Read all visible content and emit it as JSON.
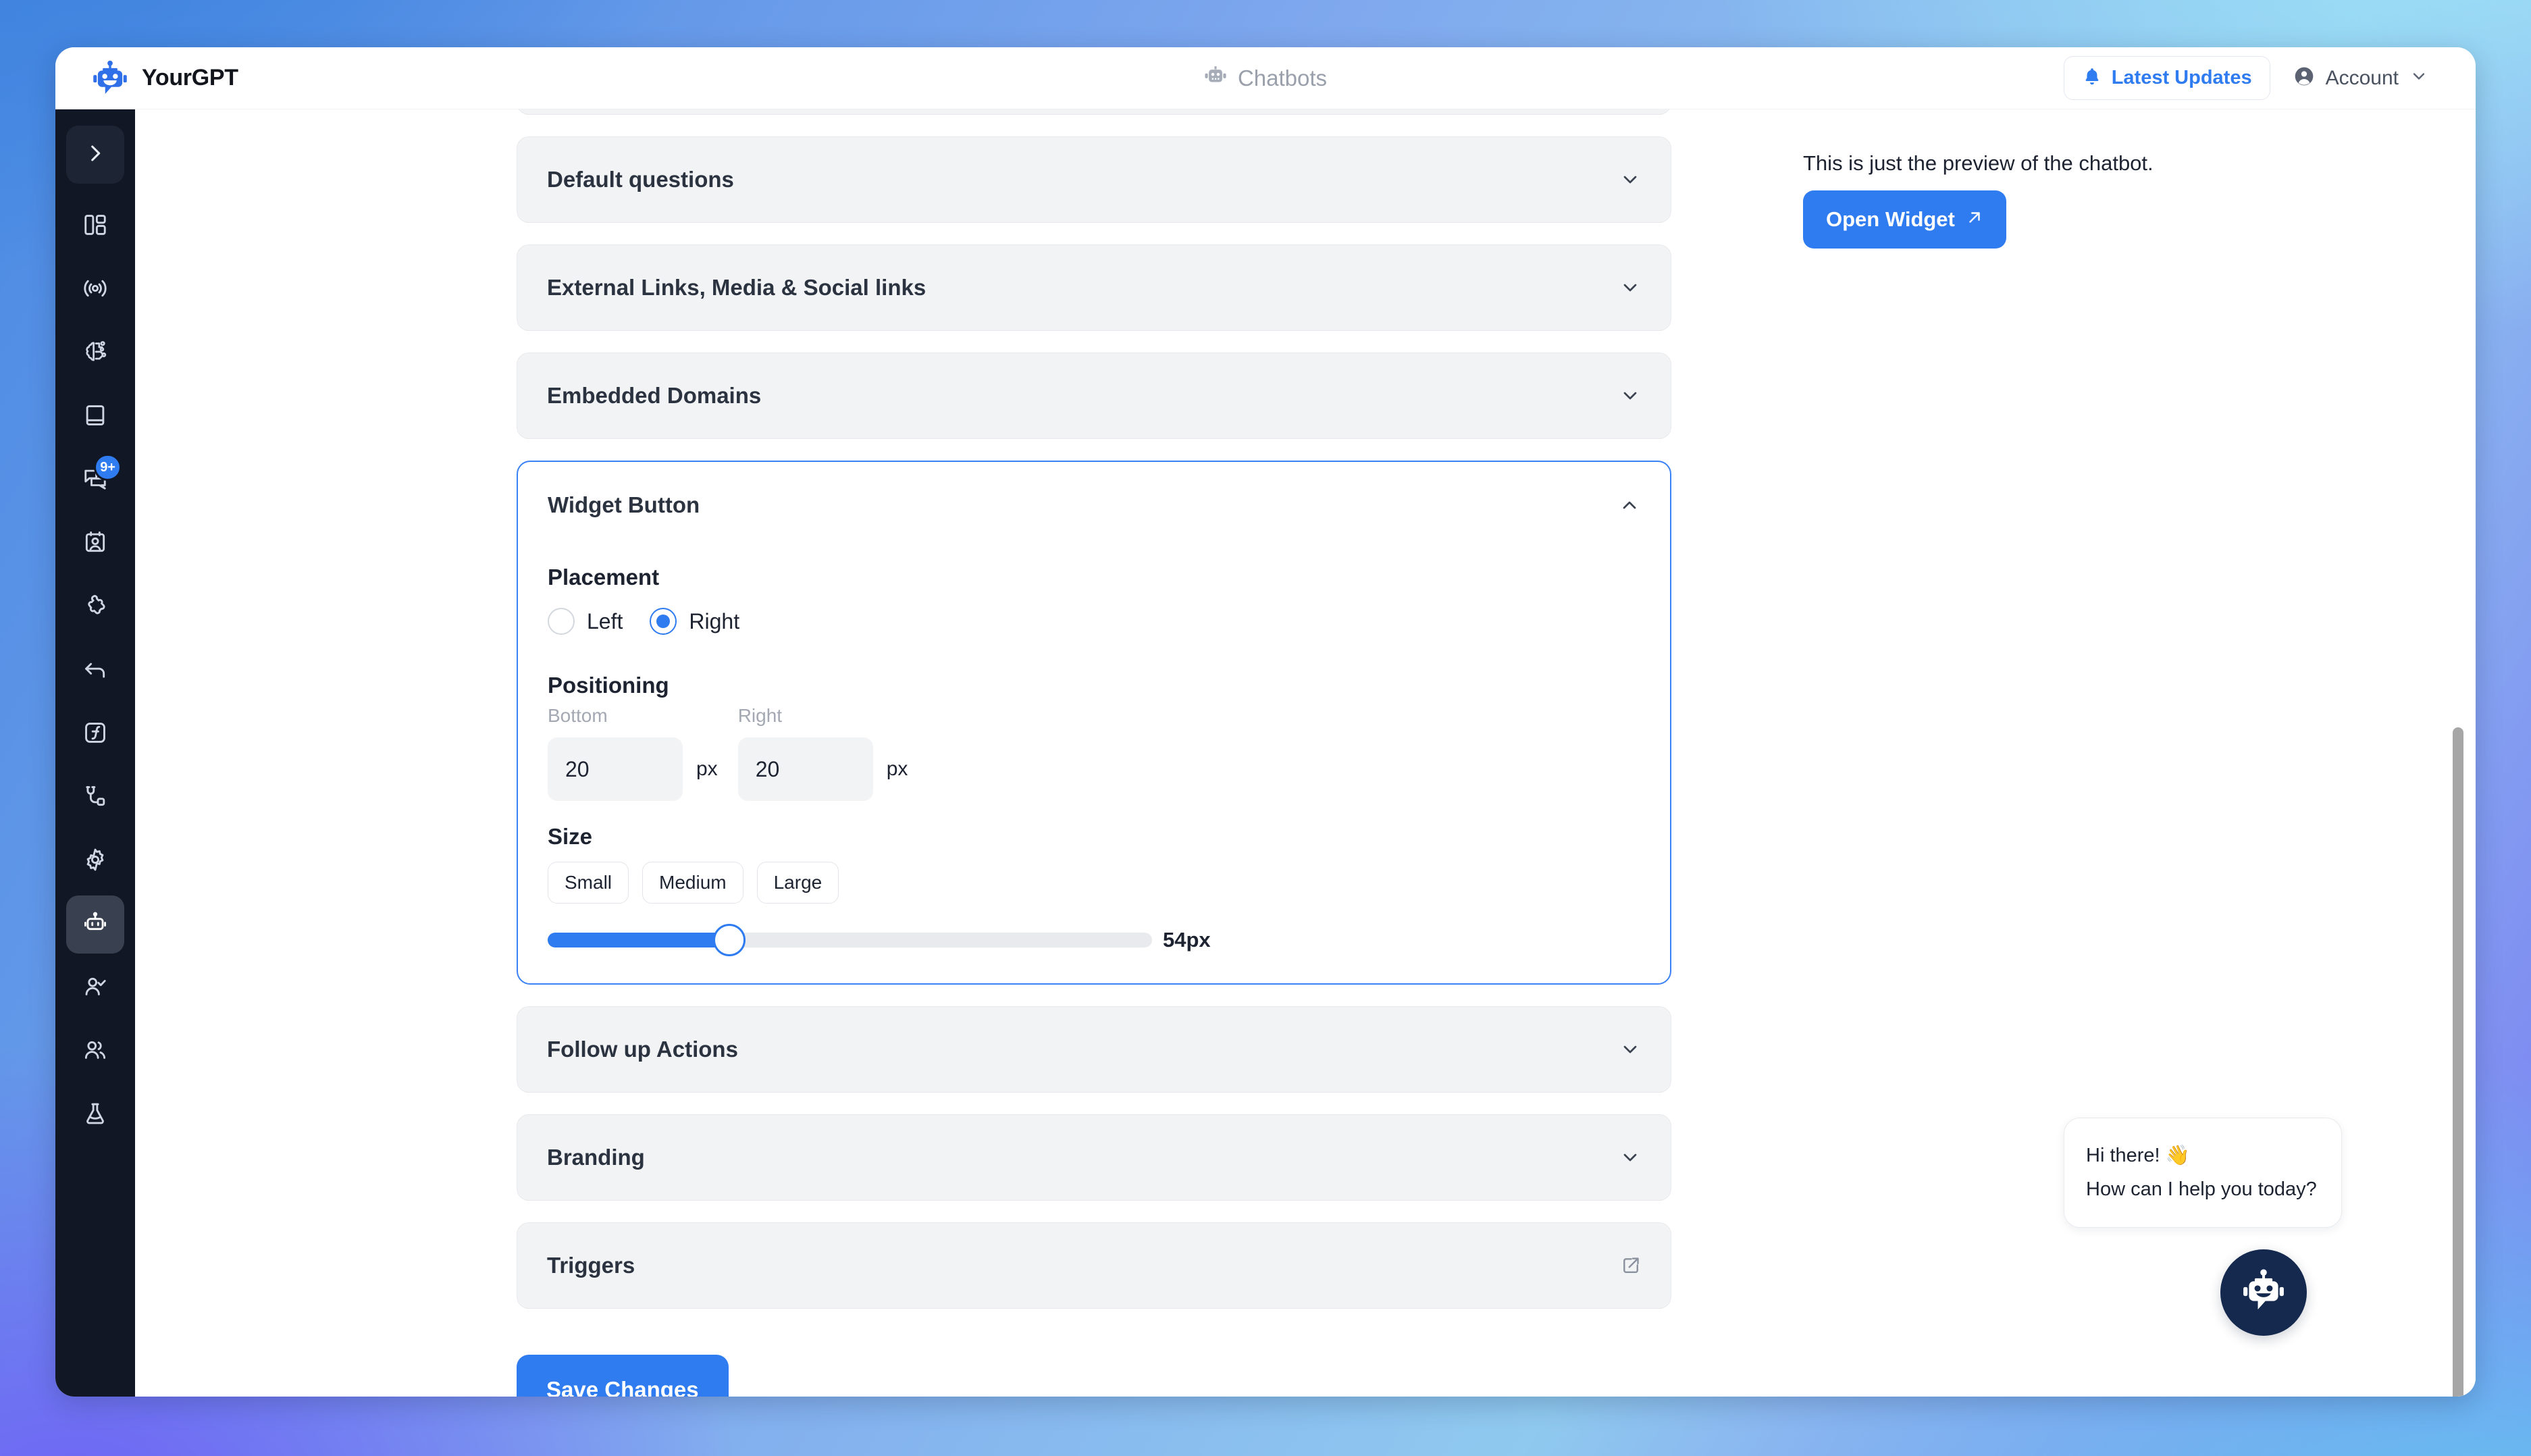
{
  "topbar": {
    "brand_name": "YourGPT",
    "brand_icon": "robot-logo-icon",
    "page_title": "Chatbots",
    "page_icon": "robot-icon",
    "updates_label": "Latest Updates",
    "updates_icon": "bell-icon",
    "account_label": "Account",
    "account_icon": "user-circle-icon",
    "account_caret_icon": "chevron-down-icon"
  },
  "sidebar": {
    "expand_icon": "chevron-right-icon",
    "items": [
      {
        "name": "dashboard",
        "icon": "layout-dashboard-icon",
        "badge": ""
      },
      {
        "name": "broadcast",
        "icon": "signal-icon",
        "badge": ""
      },
      {
        "name": "ai-brain",
        "icon": "brain-circuit-icon",
        "badge": ""
      },
      {
        "name": "knowledge",
        "icon": "book-icon",
        "badge": ""
      },
      {
        "name": "conversations",
        "icon": "chat-bubbles-icon",
        "badge": "9+"
      },
      {
        "name": "contacts",
        "icon": "contact-card-icon",
        "badge": ""
      },
      {
        "name": "integrations",
        "icon": "puzzle-icon",
        "badge": ""
      },
      {
        "name": "reply",
        "icon": "arrow-reply-icon",
        "badge": ""
      },
      {
        "name": "functions",
        "icon": "function-box-icon",
        "badge": ""
      },
      {
        "name": "connections",
        "icon": "plug-icon",
        "badge": ""
      },
      {
        "name": "settings",
        "icon": "gear-icon",
        "badge": ""
      },
      {
        "name": "chatbots",
        "icon": "robot-icon",
        "badge": ""
      },
      {
        "name": "agents",
        "icon": "user-check-icon",
        "badge": ""
      },
      {
        "name": "teams",
        "icon": "users-icon",
        "badge": ""
      },
      {
        "name": "labs",
        "icon": "flask-icon",
        "badge": ""
      }
    ]
  },
  "accordions": {
    "above": [
      {
        "label": "Default questions",
        "icon": "chevron-down-icon"
      },
      {
        "label": "External Links, Media & Social links",
        "icon": "chevron-down-icon"
      },
      {
        "label": "Embedded Domains",
        "icon": "chevron-down-icon"
      }
    ],
    "below": [
      {
        "label": "Follow up Actions",
        "icon": "chevron-down-icon"
      },
      {
        "label": "Branding",
        "icon": "chevron-down-icon"
      },
      {
        "label": "Triggers",
        "icon": "external-link-icon"
      }
    ]
  },
  "widget_button": {
    "title": "Widget Button",
    "collapse_icon": "chevron-up-icon",
    "placement": {
      "label": "Placement",
      "options": [
        "Left",
        "Right"
      ],
      "selected": "Right"
    },
    "positioning": {
      "label": "Positioning",
      "bottom_caption": "Bottom",
      "bottom_value": "20",
      "bottom_unit": "px",
      "right_caption": "Right",
      "right_value": "20",
      "right_unit": "px"
    },
    "size": {
      "label": "Size",
      "presets": [
        "Small",
        "Medium",
        "Large"
      ],
      "value_label": "54px",
      "value": 54,
      "min": 30,
      "max": 100,
      "fill_percent": 30
    }
  },
  "footer": {
    "save_label": "Save Changes"
  },
  "preview": {
    "note": "This is just the preview of the chatbot.",
    "open_widget_label": "Open Widget",
    "open_widget_icon": "arrow-up-right-icon",
    "bubble_lines": [
      "Hi there! 👋",
      "How can I help you today?"
    ],
    "fab_icon": "robot-avatar-icon"
  },
  "colors": {
    "accent": "#2f7bf0",
    "rail_bg": "#111725",
    "card_bg": "#f2f3f5",
    "fab_bg": "#15294f",
    "active_border": "#3b82f6"
  }
}
